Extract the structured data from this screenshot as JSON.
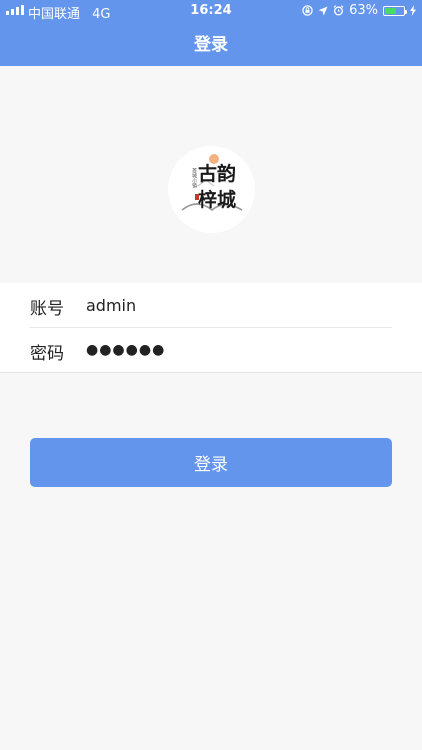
{
  "status_bar": {
    "carrier": "中国联通",
    "network": "4G",
    "time": "16:24",
    "battery_percent": "63%",
    "battery_level": 0.63,
    "icons": [
      "screen-lock-icon",
      "location-arrow-icon",
      "alarm-icon",
      "battery-icon",
      "charging-bolt-icon"
    ]
  },
  "nav": {
    "title": "登录"
  },
  "logo": {
    "main_text": "古韵梓城",
    "side_text": "首城小镇"
  },
  "form": {
    "account": {
      "label": "账号",
      "value": "admin"
    },
    "password": {
      "label": "密码",
      "value": "●●●●●●"
    }
  },
  "login_button": {
    "label": "登录"
  },
  "colors": {
    "primary": "#6495ed",
    "background": "#f7f7f7",
    "battery_green": "#4cd964",
    "logo_red": "#c0392b"
  }
}
